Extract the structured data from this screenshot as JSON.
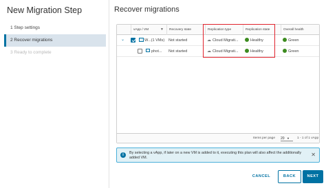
{
  "wizard": {
    "title": "New Migration Step",
    "steps": [
      {
        "label": "1  Step settings",
        "state": "done"
      },
      {
        "label": "2  Recover migrations",
        "state": "active"
      },
      {
        "label": "3  Ready to complete",
        "state": "disabled"
      }
    ]
  },
  "content": {
    "title": "Recover migrations"
  },
  "grid": {
    "columns": [
      "vApp / VM",
      "Recovery state",
      "Replication type",
      "Replication state",
      "Overall health"
    ],
    "filter_icon": "filter-icon",
    "rows": [
      {
        "name": "W...(1 VMs)",
        "recovery_state": "Not started",
        "replication_type": "Cloud Migrati...",
        "replication_state": "Healthy",
        "overall_health": "Green",
        "checked": true,
        "expanded": true
      },
      {
        "name": "phot...",
        "recovery_state": "Not started",
        "replication_type": "Cloud Migrati...",
        "replication_state": "Healthy",
        "overall_health": "Green",
        "checked": false
      }
    ],
    "footer": {
      "items_per_page_label": "Items per page",
      "items_per_page_value": "20",
      "range": "1 - 1 of 1 vApp"
    }
  },
  "alert": {
    "text": "By selecting a vApp, if later on a new VM is added to it, executing this plan will also affect the additionally added VM.",
    "close_icon": "close-icon"
  },
  "buttons": {
    "cancel": "CANCEL",
    "back": "BACK",
    "next": "NEXT"
  },
  "colors": {
    "accent": "#0072a3",
    "healthy": "#3c8b1f",
    "highlight_border": "#e1212b",
    "alert_bg": "#e1f1f6"
  }
}
